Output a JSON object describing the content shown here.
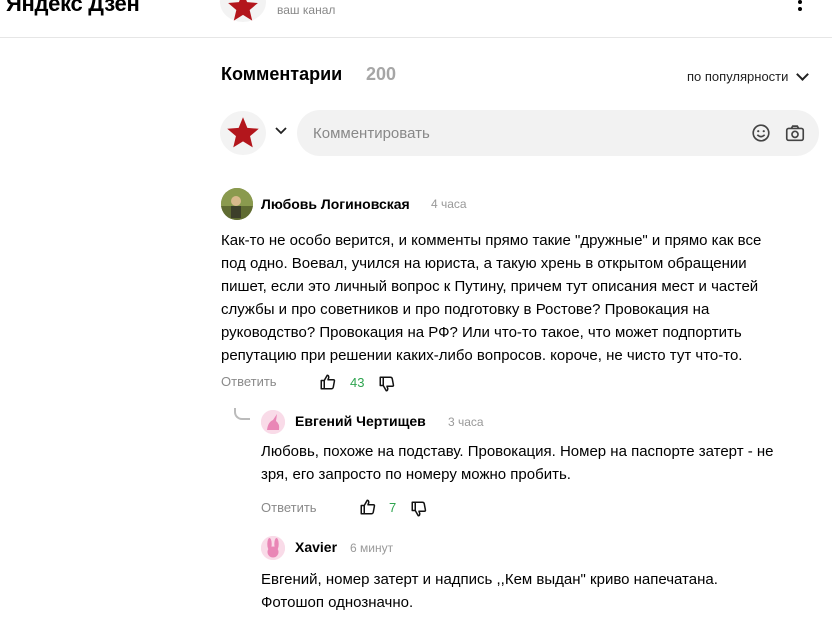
{
  "header": {
    "logo": "Яндекс Дзен",
    "channel_caption": "ваш канал",
    "more_icon": "more-vertical-icon"
  },
  "comments_section": {
    "title": "Комментарии",
    "count": "200",
    "sort_label": "по популярности",
    "input_placeholder": "Комментировать",
    "icons": [
      "star-avatar-icon",
      "chevron-down-icon",
      "emoji-icon",
      "camera-icon"
    ]
  },
  "comments": [
    {
      "author": "Любовь Логиновская",
      "time": "4 часа",
      "lines": [
        "Как-то не особо верится, и комменты прямо такие \"дружные\" и прямо как все",
        "под одно. Воевал, учился на юриста, а такую хрень в открытом обращении",
        "пишет, если это личный вопрос к Путину, причем тут описания мест и частей",
        "службы и про советников и про подготовку в Ростове? Провокация на",
        "руководство? Провокация на РФ? Или что-то такое, что может подпортить",
        "репутацию при решении каких-либо вопросов. короче, не чисто тут что-то."
      ],
      "reply_label": "Ответить",
      "likes": "43"
    },
    {
      "author": "Евгений Чертищев",
      "time": "3 часа",
      "lines": [
        "Любовь, похоже на подставу. Провокация. Номер на паспорте затерт - не",
        "зря, его запросто по номеру можно пробить."
      ],
      "reply_label": "Ответить",
      "likes": "7"
    },
    {
      "author": "Xavier",
      "time": "6 минут",
      "lines": [
        "Евгений, номер затерт и надпись ,,Кем выдан\" криво напечатана.",
        "Фотошоп однозначно."
      ]
    }
  ],
  "colors": {
    "accent_star": "#b3161c",
    "like_green": "#2ea44f",
    "muted_text": "#8a8a8a",
    "input_bg": "#f2f2f2"
  }
}
